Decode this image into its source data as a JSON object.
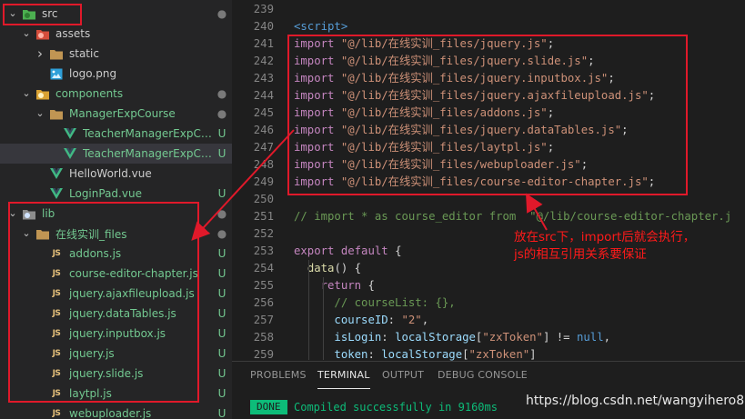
{
  "explorer": {
    "items": [
      {
        "label": "src",
        "depth": 0,
        "chevron": "down",
        "icon": "folder-src-icon",
        "status": "dot",
        "labelColor": "#cccccc"
      },
      {
        "label": "assets",
        "depth": 1,
        "chevron": "down",
        "icon": "folder-assets-icon",
        "status": "",
        "labelColor": "#cccccc"
      },
      {
        "label": "static",
        "depth": 2,
        "chevron": "right",
        "icon": "folder-icon",
        "status": "",
        "labelColor": "#cccccc"
      },
      {
        "label": "logo.png",
        "depth": 2,
        "chevron": "",
        "icon": "image-icon",
        "status": "",
        "labelColor": "#cccccc"
      },
      {
        "label": "components",
        "depth": 1,
        "chevron": "down",
        "icon": "folder-components-icon",
        "status": "dot",
        "labelColor": "#73c991"
      },
      {
        "label": "ManagerExpCourse",
        "depth": 2,
        "chevron": "down",
        "icon": "folder-icon",
        "status": "dot",
        "labelColor": "#73c991"
      },
      {
        "label": "TeacherManagerExpCours...",
        "depth": 3,
        "chevron": "",
        "icon": "vue-icon",
        "status": "U",
        "labelColor": "#73c991"
      },
      {
        "label": "TeacherManagerExpCours...",
        "depth": 3,
        "chevron": "",
        "icon": "vue-icon",
        "status": "U",
        "labelColor": "#73c991",
        "selected": true
      },
      {
        "label": "HelloWorld.vue",
        "depth": 2,
        "chevron": "",
        "icon": "vue-icon",
        "status": "",
        "labelColor": "#cccccc"
      },
      {
        "label": "LoginPad.vue",
        "depth": 2,
        "chevron": "",
        "icon": "vue-icon",
        "status": "U",
        "labelColor": "#73c991"
      },
      {
        "label": "lib",
        "depth": 0,
        "chevron": "down",
        "icon": "folder-lib-icon",
        "status": "dot",
        "labelColor": "#73c991"
      },
      {
        "label": "在线实训_files",
        "depth": 1,
        "chevron": "down",
        "icon": "folder-icon",
        "status": "dot",
        "labelColor": "#73c991"
      },
      {
        "label": "addons.js",
        "depth": 2,
        "chevron": "",
        "icon": "js-icon",
        "status": "U",
        "labelColor": "#73c991"
      },
      {
        "label": "course-editor-chapter.js",
        "depth": 2,
        "chevron": "",
        "icon": "js-icon",
        "status": "U",
        "labelColor": "#73c991"
      },
      {
        "label": "jquery.ajaxfileupload.js",
        "depth": 2,
        "chevron": "",
        "icon": "js-icon",
        "status": "U",
        "labelColor": "#73c991"
      },
      {
        "label": "jquery.dataTables.js",
        "depth": 2,
        "chevron": "",
        "icon": "js-icon",
        "status": "U",
        "labelColor": "#73c991"
      },
      {
        "label": "jquery.inputbox.js",
        "depth": 2,
        "chevron": "",
        "icon": "js-icon",
        "status": "U",
        "labelColor": "#73c991"
      },
      {
        "label": "jquery.js",
        "depth": 2,
        "chevron": "",
        "icon": "js-icon",
        "status": "U",
        "labelColor": "#73c991"
      },
      {
        "label": "jquery.slide.js",
        "depth": 2,
        "chevron": "",
        "icon": "js-icon",
        "status": "U",
        "labelColor": "#73c991"
      },
      {
        "label": "laytpl.js",
        "depth": 2,
        "chevron": "",
        "icon": "js-icon",
        "status": "U",
        "labelColor": "#73c991"
      },
      {
        "label": "webuploader.js",
        "depth": 2,
        "chevron": "",
        "icon": "js-icon",
        "status": "U",
        "labelColor": "#73c991"
      }
    ],
    "js_icon_text": "JS"
  },
  "editor": {
    "lines": [
      {
        "n": "239",
        "tokens": []
      },
      {
        "n": "240",
        "tokens": [
          {
            "t": "<script>",
            "c": "tag"
          }
        ]
      },
      {
        "n": "241",
        "tokens": [
          {
            "t": "import ",
            "c": "kw"
          },
          {
            "t": "\"@/lib/在线实训_files/jquery.js\"",
            "c": "str"
          },
          {
            "t": ";",
            "c": ""
          }
        ]
      },
      {
        "n": "242",
        "tokens": [
          {
            "t": "import ",
            "c": "kw"
          },
          {
            "t": "\"@/lib/在线实训_files/jquery.slide.js\"",
            "c": "str"
          },
          {
            "t": ";",
            "c": ""
          }
        ]
      },
      {
        "n": "243",
        "tokens": [
          {
            "t": "import ",
            "c": "kw"
          },
          {
            "t": "\"@/lib/在线实训_files/jquery.inputbox.js\"",
            "c": "str"
          },
          {
            "t": ";",
            "c": ""
          }
        ]
      },
      {
        "n": "244",
        "tokens": [
          {
            "t": "import ",
            "c": "kw"
          },
          {
            "t": "\"@/lib/在线实训_files/jquery.ajaxfileupload.js\"",
            "c": "str"
          },
          {
            "t": ";",
            "c": ""
          }
        ]
      },
      {
        "n": "245",
        "tokens": [
          {
            "t": "import ",
            "c": "kw"
          },
          {
            "t": "\"@/lib/在线实训_files/addons.js\"",
            "c": "str"
          },
          {
            "t": ";",
            "c": ""
          }
        ]
      },
      {
        "n": "246",
        "tokens": [
          {
            "t": "import ",
            "c": "kw"
          },
          {
            "t": "\"@/lib/在线实训_files/jquery.dataTables.js\"",
            "c": "str"
          },
          {
            "t": ";",
            "c": ""
          }
        ]
      },
      {
        "n": "247",
        "tokens": [
          {
            "t": "import ",
            "c": "kw"
          },
          {
            "t": "\"@/lib/在线实训_files/laytpl.js\"",
            "c": "str"
          },
          {
            "t": ";",
            "c": ""
          }
        ]
      },
      {
        "n": "248",
        "tokens": [
          {
            "t": "import ",
            "c": "kw"
          },
          {
            "t": "\"@/lib/在线实训_files/webuploader.js\"",
            "c": "str"
          },
          {
            "t": ";",
            "c": ""
          }
        ]
      },
      {
        "n": "249",
        "tokens": [
          {
            "t": "import ",
            "c": "kw"
          },
          {
            "t": "\"@/lib/在线实训_files/course-editor-chapter.js\"",
            "c": "str"
          },
          {
            "t": ";",
            "c": ""
          }
        ]
      },
      {
        "n": "250",
        "tokens": []
      },
      {
        "n": "251",
        "tokens": [
          {
            "t": "// import * as course_editor from  \"@/lib/course-editor-chapter.j",
            "c": "cmt"
          }
        ]
      },
      {
        "n": "252",
        "tokens": []
      },
      {
        "n": "253",
        "tokens": [
          {
            "t": "export ",
            "c": "kw"
          },
          {
            "t": "default ",
            "c": "kw"
          },
          {
            "t": "{",
            "c": ""
          }
        ]
      },
      {
        "n": "254",
        "tokens": [
          {
            "t": "  ",
            "c": ""
          },
          {
            "t": "data",
            "c": "fn"
          },
          {
            "t": "() {",
            "c": ""
          }
        ]
      },
      {
        "n": "255",
        "tokens": [
          {
            "t": "    ",
            "c": ""
          },
          {
            "t": "return ",
            "c": "kw"
          },
          {
            "t": "{",
            "c": ""
          }
        ]
      },
      {
        "n": "256",
        "tokens": [
          {
            "t": "      ",
            "c": ""
          },
          {
            "t": "// courseList: {},",
            "c": "cmt"
          }
        ]
      },
      {
        "n": "257",
        "tokens": [
          {
            "t": "      ",
            "c": ""
          },
          {
            "t": "courseID",
            "c": "var"
          },
          {
            "t": ": ",
            "c": ""
          },
          {
            "t": "\"2\"",
            "c": "str"
          },
          {
            "t": ",",
            "c": ""
          }
        ]
      },
      {
        "n": "258",
        "tokens": [
          {
            "t": "      ",
            "c": ""
          },
          {
            "t": "isLogin",
            "c": "var"
          },
          {
            "t": ": ",
            "c": ""
          },
          {
            "t": "localStorage",
            "c": "var"
          },
          {
            "t": "[",
            "c": ""
          },
          {
            "t": "\"zxToken\"",
            "c": "str"
          },
          {
            "t": "] != ",
            "c": ""
          },
          {
            "t": "null",
            "c": "kw2"
          },
          {
            "t": ",",
            "c": ""
          }
        ]
      },
      {
        "n": "259",
        "tokens": [
          {
            "t": "      ",
            "c": ""
          },
          {
            "t": "token",
            "c": "var"
          },
          {
            "t": ": ",
            "c": ""
          },
          {
            "t": "localStorage",
            "c": "var"
          },
          {
            "t": "[",
            "c": ""
          },
          {
            "t": "\"zxToken\"",
            "c": "str"
          },
          {
            "t": "]",
            "c": ""
          }
        ]
      }
    ]
  },
  "panel": {
    "tabs": [
      "PROBLEMS",
      "TERMINAL",
      "OUTPUT",
      "DEBUG CONSOLE"
    ],
    "active_tab": "TERMINAL",
    "badge": "DONE",
    "message": "Compiled successfully in 9160ms"
  },
  "annotation": {
    "lines": [
      "放在src下，import后就会执行，",
      "js的相互引用关系要保证"
    ],
    "color": "#e0192a"
  },
  "watermark": "https://blog.csdn.net/wangyihero8"
}
